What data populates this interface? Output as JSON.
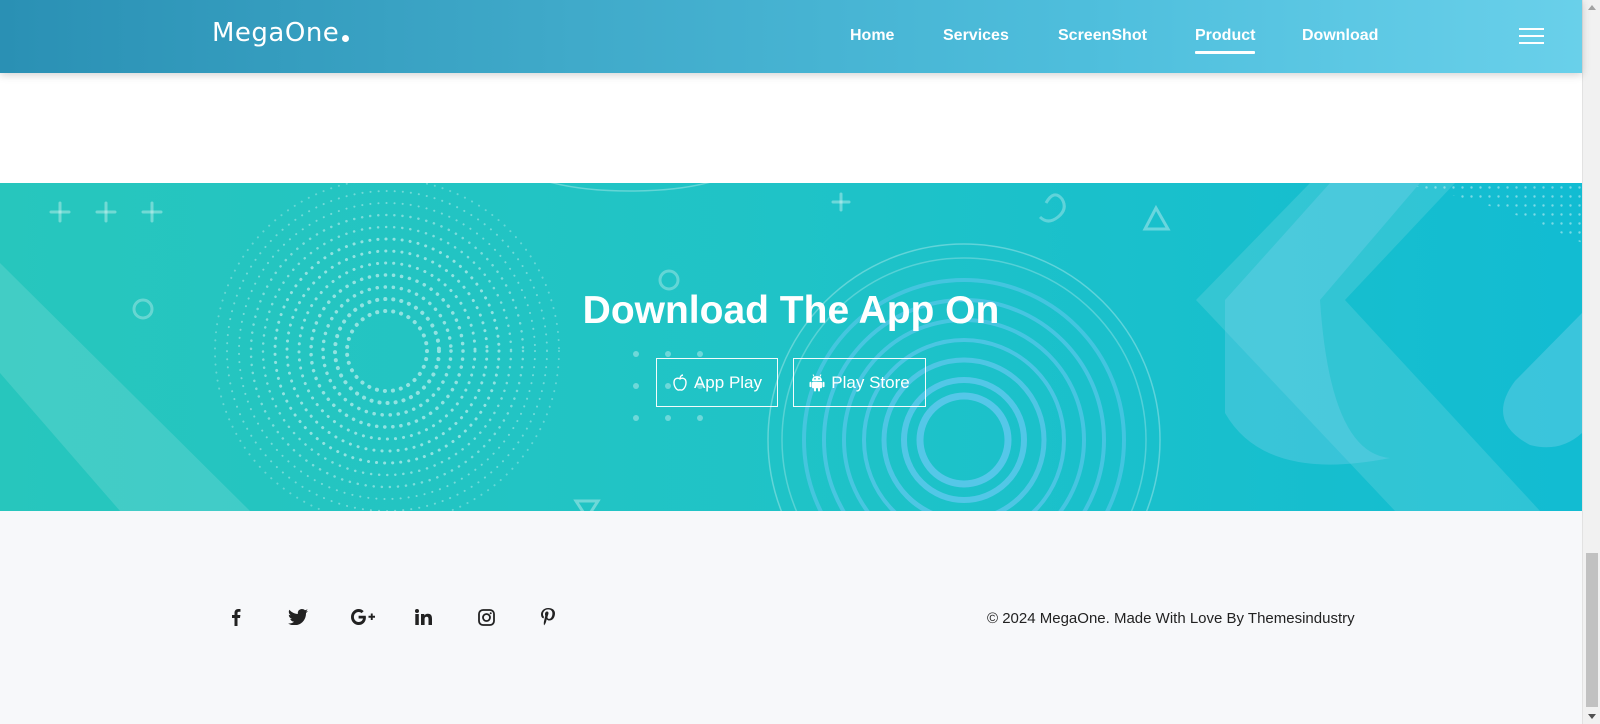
{
  "header": {
    "logo": "MegaOne",
    "nav": [
      {
        "label": "Home",
        "active": false
      },
      {
        "label": "Services",
        "active": false
      },
      {
        "label": "ScreenShot",
        "active": false
      },
      {
        "label": "Product",
        "active": true
      },
      {
        "label": "Download",
        "active": false
      }
    ],
    "menu_icon": "hamburger-icon"
  },
  "download": {
    "title": "Download The App On",
    "buttons": [
      {
        "label": "App Play",
        "icon": "apple-icon"
      },
      {
        "label": "Play Store",
        "icon": "android-icon"
      }
    ]
  },
  "footer": {
    "social": [
      "facebook-icon",
      "twitter-icon",
      "google-plus-icon",
      "linkedin-icon",
      "instagram-icon",
      "pinterest-icon"
    ],
    "copyright": "© 2024 MegaOne. Made With Love By Themesindustry"
  },
  "colors": {
    "header_start": "#2a90b4",
    "header_end": "#69d0ea",
    "band_start": "#27c6bd",
    "band_end": "#12bcd2",
    "footer_bg": "#f7f8fa",
    "text_dark": "#222222"
  }
}
